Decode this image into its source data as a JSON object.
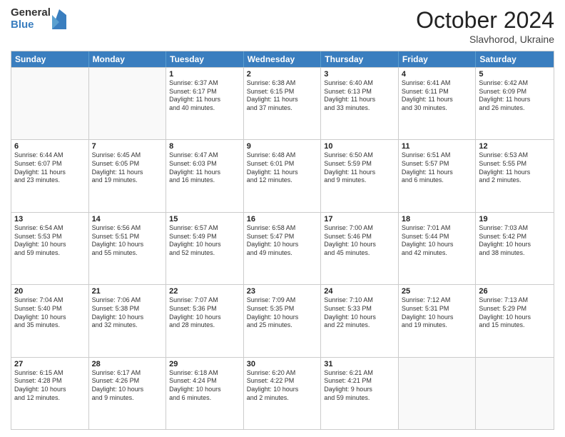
{
  "header": {
    "logo_general": "General",
    "logo_blue": "Blue",
    "month_title": "October 2024",
    "location": "Slavhorod, Ukraine"
  },
  "days_of_week": [
    "Sunday",
    "Monday",
    "Tuesday",
    "Wednesday",
    "Thursday",
    "Friday",
    "Saturday"
  ],
  "weeks": [
    [
      {
        "day": "",
        "empty": true
      },
      {
        "day": "",
        "empty": true
      },
      {
        "day": "1",
        "lines": [
          "Sunrise: 6:37 AM",
          "Sunset: 6:17 PM",
          "Daylight: 11 hours",
          "and 40 minutes."
        ]
      },
      {
        "day": "2",
        "lines": [
          "Sunrise: 6:38 AM",
          "Sunset: 6:15 PM",
          "Daylight: 11 hours",
          "and 37 minutes."
        ]
      },
      {
        "day": "3",
        "lines": [
          "Sunrise: 6:40 AM",
          "Sunset: 6:13 PM",
          "Daylight: 11 hours",
          "and 33 minutes."
        ]
      },
      {
        "day": "4",
        "lines": [
          "Sunrise: 6:41 AM",
          "Sunset: 6:11 PM",
          "Daylight: 11 hours",
          "and 30 minutes."
        ]
      },
      {
        "day": "5",
        "lines": [
          "Sunrise: 6:42 AM",
          "Sunset: 6:09 PM",
          "Daylight: 11 hours",
          "and 26 minutes."
        ]
      }
    ],
    [
      {
        "day": "6",
        "lines": [
          "Sunrise: 6:44 AM",
          "Sunset: 6:07 PM",
          "Daylight: 11 hours",
          "and 23 minutes."
        ]
      },
      {
        "day": "7",
        "lines": [
          "Sunrise: 6:45 AM",
          "Sunset: 6:05 PM",
          "Daylight: 11 hours",
          "and 19 minutes."
        ]
      },
      {
        "day": "8",
        "lines": [
          "Sunrise: 6:47 AM",
          "Sunset: 6:03 PM",
          "Daylight: 11 hours",
          "and 16 minutes."
        ]
      },
      {
        "day": "9",
        "lines": [
          "Sunrise: 6:48 AM",
          "Sunset: 6:01 PM",
          "Daylight: 11 hours",
          "and 12 minutes."
        ]
      },
      {
        "day": "10",
        "lines": [
          "Sunrise: 6:50 AM",
          "Sunset: 5:59 PM",
          "Daylight: 11 hours",
          "and 9 minutes."
        ]
      },
      {
        "day": "11",
        "lines": [
          "Sunrise: 6:51 AM",
          "Sunset: 5:57 PM",
          "Daylight: 11 hours",
          "and 6 minutes."
        ]
      },
      {
        "day": "12",
        "lines": [
          "Sunrise: 6:53 AM",
          "Sunset: 5:55 PM",
          "Daylight: 11 hours",
          "and 2 minutes."
        ]
      }
    ],
    [
      {
        "day": "13",
        "lines": [
          "Sunrise: 6:54 AM",
          "Sunset: 5:53 PM",
          "Daylight: 10 hours",
          "and 59 minutes."
        ]
      },
      {
        "day": "14",
        "lines": [
          "Sunrise: 6:56 AM",
          "Sunset: 5:51 PM",
          "Daylight: 10 hours",
          "and 55 minutes."
        ]
      },
      {
        "day": "15",
        "lines": [
          "Sunrise: 6:57 AM",
          "Sunset: 5:49 PM",
          "Daylight: 10 hours",
          "and 52 minutes."
        ]
      },
      {
        "day": "16",
        "lines": [
          "Sunrise: 6:58 AM",
          "Sunset: 5:47 PM",
          "Daylight: 10 hours",
          "and 49 minutes."
        ]
      },
      {
        "day": "17",
        "lines": [
          "Sunrise: 7:00 AM",
          "Sunset: 5:46 PM",
          "Daylight: 10 hours",
          "and 45 minutes."
        ]
      },
      {
        "day": "18",
        "lines": [
          "Sunrise: 7:01 AM",
          "Sunset: 5:44 PM",
          "Daylight: 10 hours",
          "and 42 minutes."
        ]
      },
      {
        "day": "19",
        "lines": [
          "Sunrise: 7:03 AM",
          "Sunset: 5:42 PM",
          "Daylight: 10 hours",
          "and 38 minutes."
        ]
      }
    ],
    [
      {
        "day": "20",
        "lines": [
          "Sunrise: 7:04 AM",
          "Sunset: 5:40 PM",
          "Daylight: 10 hours",
          "and 35 minutes."
        ]
      },
      {
        "day": "21",
        "lines": [
          "Sunrise: 7:06 AM",
          "Sunset: 5:38 PM",
          "Daylight: 10 hours",
          "and 32 minutes."
        ]
      },
      {
        "day": "22",
        "lines": [
          "Sunrise: 7:07 AM",
          "Sunset: 5:36 PM",
          "Daylight: 10 hours",
          "and 28 minutes."
        ]
      },
      {
        "day": "23",
        "lines": [
          "Sunrise: 7:09 AM",
          "Sunset: 5:35 PM",
          "Daylight: 10 hours",
          "and 25 minutes."
        ]
      },
      {
        "day": "24",
        "lines": [
          "Sunrise: 7:10 AM",
          "Sunset: 5:33 PM",
          "Daylight: 10 hours",
          "and 22 minutes."
        ]
      },
      {
        "day": "25",
        "lines": [
          "Sunrise: 7:12 AM",
          "Sunset: 5:31 PM",
          "Daylight: 10 hours",
          "and 19 minutes."
        ]
      },
      {
        "day": "26",
        "lines": [
          "Sunrise: 7:13 AM",
          "Sunset: 5:29 PM",
          "Daylight: 10 hours",
          "and 15 minutes."
        ]
      }
    ],
    [
      {
        "day": "27",
        "lines": [
          "Sunrise: 6:15 AM",
          "Sunset: 4:28 PM",
          "Daylight: 10 hours",
          "and 12 minutes."
        ]
      },
      {
        "day": "28",
        "lines": [
          "Sunrise: 6:17 AM",
          "Sunset: 4:26 PM",
          "Daylight: 10 hours",
          "and 9 minutes."
        ]
      },
      {
        "day": "29",
        "lines": [
          "Sunrise: 6:18 AM",
          "Sunset: 4:24 PM",
          "Daylight: 10 hours",
          "and 6 minutes."
        ]
      },
      {
        "day": "30",
        "lines": [
          "Sunrise: 6:20 AM",
          "Sunset: 4:22 PM",
          "Daylight: 10 hours",
          "and 2 minutes."
        ]
      },
      {
        "day": "31",
        "lines": [
          "Sunrise: 6:21 AM",
          "Sunset: 4:21 PM",
          "Daylight: 9 hours",
          "and 59 minutes."
        ]
      },
      {
        "day": "",
        "empty": true
      },
      {
        "day": "",
        "empty": true
      }
    ]
  ]
}
